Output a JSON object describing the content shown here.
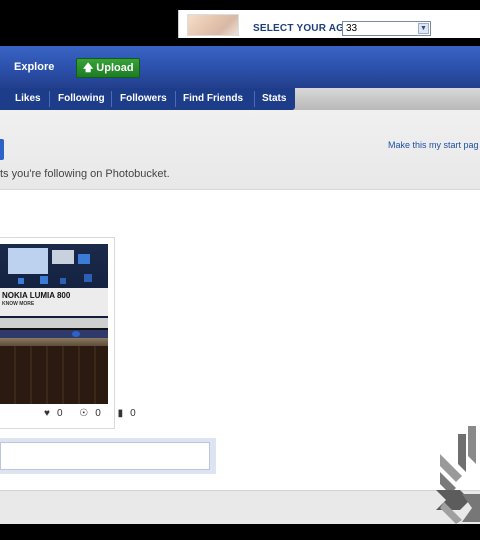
{
  "ad": {
    "age_label": "SELECT YOUR AGE:",
    "age_value": "33"
  },
  "nav": {
    "explore": "Explore",
    "upload": "Upload"
  },
  "subnav": {
    "items": [
      "Likes",
      "Following",
      "Followers",
      "Find Friends",
      "Stats"
    ]
  },
  "page": {
    "start_link": "Make this my start pag",
    "description": "ts you're following on Photobucket."
  },
  "photo_card": {
    "screen_title": "NOKIA LUMIA 800",
    "screen_sub": "KNOW MORE",
    "likes": "0",
    "views": "0",
    "comments": "0"
  },
  "colors": {
    "nav_blue": "#2b50ab",
    "subnav_blue": "#1d3d8a",
    "upload_green": "#1c7d22",
    "link_blue": "#1e4ea8"
  }
}
